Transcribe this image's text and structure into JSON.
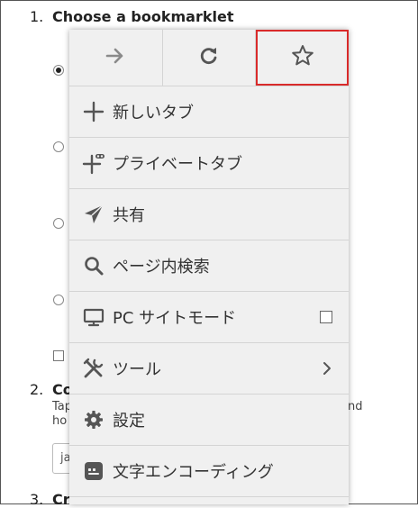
{
  "background": {
    "step1": {
      "num": "1.",
      "title": "Choose a bookmarklet"
    },
    "step2": {
      "num": "2.",
      "title_fragment": "Co",
      "line1_start": "Tap",
      "line1_end": "nd",
      "line2_start": "ho"
    },
    "step3": {
      "num": "3.",
      "title_fragment": "Cr"
    },
    "input_value": "ja"
  },
  "menu": {
    "toolbar": [
      {
        "name": "forward-button",
        "icon": "arrow-right-icon"
      },
      {
        "name": "reload-button",
        "icon": "reload-icon"
      },
      {
        "name": "bookmark-star-button",
        "icon": "star-icon",
        "highlighted": true
      }
    ],
    "items": [
      {
        "label": "新しいタブ",
        "icon": "plus-icon"
      },
      {
        "label": "プライベートタブ",
        "icon": "private-tab-icon"
      },
      {
        "label": "共有",
        "icon": "share-icon"
      },
      {
        "label": "ページ内検索",
        "icon": "search-icon"
      },
      {
        "label": "PC サイトモード",
        "icon": "desktop-icon",
        "checkbox": false
      },
      {
        "label": "ツール",
        "icon": "tools-icon",
        "submenu": true
      },
      {
        "label": "設定",
        "icon": "gear-icon"
      },
      {
        "label": "文字エンコーディング",
        "icon": "encoding-icon"
      }
    ]
  },
  "colors": {
    "highlight": "#d92a2a",
    "menu_bg": "#f0f0f0",
    "icon": "#555555"
  }
}
